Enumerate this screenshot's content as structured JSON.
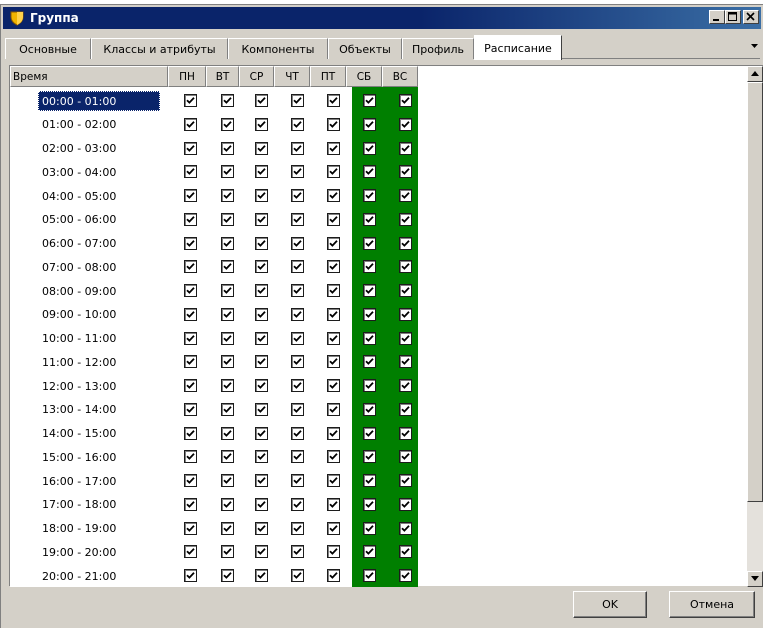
{
  "window": {
    "title": "Группа",
    "controls": [
      "minimize-icon",
      "maximize-icon",
      "close-icon"
    ]
  },
  "tabs": [
    {
      "label": "Основные",
      "active": false
    },
    {
      "label": "Классы и атрибуты",
      "active": false
    },
    {
      "label": "Компоненты",
      "active": false
    },
    {
      "label": "Объекты",
      "active": false
    },
    {
      "label": "Профиль",
      "active": false
    },
    {
      "label": "Расписание",
      "active": true
    }
  ],
  "grid": {
    "time_header": "Время",
    "days": [
      "ПН",
      "ВТ",
      "СР",
      "ЧТ",
      "ПТ",
      "СБ",
      "ВС"
    ],
    "weekend_color": "#007f00",
    "selection_color": "#0a246a",
    "selected_row": 0,
    "rows": [
      {
        "time": "00:00 - 01:00",
        "checked": [
          true,
          true,
          true,
          true,
          true,
          true,
          true
        ]
      },
      {
        "time": "01:00 - 02:00",
        "checked": [
          true,
          true,
          true,
          true,
          true,
          true,
          true
        ]
      },
      {
        "time": "02:00 - 03:00",
        "checked": [
          true,
          true,
          true,
          true,
          true,
          true,
          true
        ]
      },
      {
        "time": "03:00 - 04:00",
        "checked": [
          true,
          true,
          true,
          true,
          true,
          true,
          true
        ]
      },
      {
        "time": "04:00 - 05:00",
        "checked": [
          true,
          true,
          true,
          true,
          true,
          true,
          true
        ]
      },
      {
        "time": "05:00 - 06:00",
        "checked": [
          true,
          true,
          true,
          true,
          true,
          true,
          true
        ]
      },
      {
        "time": "06:00 - 07:00",
        "checked": [
          true,
          true,
          true,
          true,
          true,
          true,
          true
        ]
      },
      {
        "time": "07:00 - 08:00",
        "checked": [
          true,
          true,
          true,
          true,
          true,
          true,
          true
        ]
      },
      {
        "time": "08:00 - 09:00",
        "checked": [
          true,
          true,
          true,
          true,
          true,
          true,
          true
        ]
      },
      {
        "time": "09:00 - 10:00",
        "checked": [
          true,
          true,
          true,
          true,
          true,
          true,
          true
        ]
      },
      {
        "time": "10:00 - 11:00",
        "checked": [
          true,
          true,
          true,
          true,
          true,
          true,
          true
        ]
      },
      {
        "time": "11:00 - 12:00",
        "checked": [
          true,
          true,
          true,
          true,
          true,
          true,
          true
        ]
      },
      {
        "time": "12:00 - 13:00",
        "checked": [
          true,
          true,
          true,
          true,
          true,
          true,
          true
        ]
      },
      {
        "time": "13:00 - 14:00",
        "checked": [
          true,
          true,
          true,
          true,
          true,
          true,
          true
        ]
      },
      {
        "time": "14:00 - 15:00",
        "checked": [
          true,
          true,
          true,
          true,
          true,
          true,
          true
        ]
      },
      {
        "time": "15:00 - 16:00",
        "checked": [
          true,
          true,
          true,
          true,
          true,
          true,
          true
        ]
      },
      {
        "time": "16:00 - 17:00",
        "checked": [
          true,
          true,
          true,
          true,
          true,
          true,
          true
        ]
      },
      {
        "time": "17:00 - 18:00",
        "checked": [
          true,
          true,
          true,
          true,
          true,
          true,
          true
        ]
      },
      {
        "time": "18:00 - 19:00",
        "checked": [
          true,
          true,
          true,
          true,
          true,
          true,
          true
        ]
      },
      {
        "time": "19:00 - 20:00",
        "checked": [
          true,
          true,
          true,
          true,
          true,
          true,
          true
        ]
      },
      {
        "time": "20:00 - 21:00",
        "checked": [
          true,
          true,
          true,
          true,
          true,
          true,
          true
        ]
      }
    ]
  },
  "buttons": {
    "ok_label": "OK",
    "cancel_label": "Отмена"
  }
}
